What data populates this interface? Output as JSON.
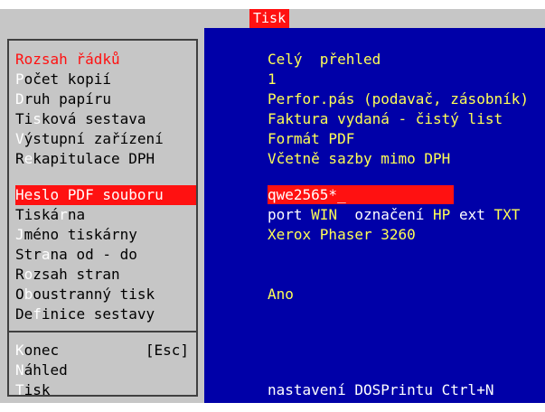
{
  "window": {
    "title": "Tisk"
  },
  "menu": {
    "items": [
      {
        "pre": "",
        "hot": "",
        "post": "Rozsah řádků"
      },
      {
        "pre": "",
        "hot": "P",
        "post": "očet kopií"
      },
      {
        "pre": "",
        "hot": "D",
        "post": "ruh papíru"
      },
      {
        "pre": "Ti",
        "hot": "s",
        "post": "ková sestava"
      },
      {
        "pre": "",
        "hot": "V",
        "post": "ýstupní zařízení"
      },
      {
        "pre": "R",
        "hot": "e",
        "post": "kapitulace DPH"
      },
      {
        "pre": "",
        "hot": "",
        "post": "Heslo PDF souboru"
      },
      {
        "pre": "Tiská",
        "hot": "r",
        "post": "na"
      },
      {
        "pre": "",
        "hot": "J",
        "post": "méno tiskárny"
      },
      {
        "pre": "Str",
        "hot": "a",
        "post": "na od - do"
      },
      {
        "pre": "R",
        "hot": "o",
        "post": "zsah stran"
      },
      {
        "pre": "O",
        "hot": "b",
        "post": "oustranný tisk"
      },
      {
        "pre": "De",
        "hot": "f",
        "post": "inice sestavy"
      }
    ],
    "commands": [
      {
        "pre": "",
        "hot": "K",
        "post": "onec",
        "key": "[Esc]"
      },
      {
        "pre": "",
        "hot": "N",
        "post": "áhled",
        "key": ""
      },
      {
        "pre": "",
        "hot": "T",
        "post": "isk",
        "key": ""
      }
    ]
  },
  "values": {
    "rozsah_radku": "Celý  přehled",
    "pocet_kopii": "1",
    "druh_papiru": "Perfor.pás (podavač, zásobník)",
    "tiskova_sestava": "Faktura vydaná - čistý list",
    "vystupni_zarizeni": "Formát PDF",
    "rekapitulace_dph": "Včetně sazby mimo DPH",
    "heslo_pdf": "qwe2565*",
    "heslo_cursor": "_",
    "tiskarna": {
      "p1": "port ",
      "p2": "WIN",
      "p3": "  označení ",
      "p4": "HP",
      "p5": " ext ",
      "p6": "TXT"
    },
    "jmeno_tiskarny": "Xerox Phaser 3260",
    "oboustranny_tisk": "Ano",
    "footer": "nastavení DOSPrintu Ctrl+N"
  },
  "colors": {
    "menu_bg": "#c6c6c6",
    "panel_bg": "#0000a8",
    "highlight": "#ff1111",
    "value_yellow": "#ffff55"
  }
}
